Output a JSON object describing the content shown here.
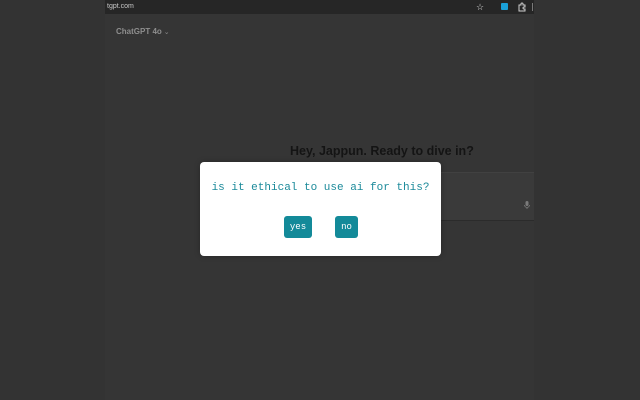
{
  "browser": {
    "url": "tgpt.com",
    "bookmark_icon": "star-icon",
    "extension_icons": [
      "extension-badge-icon",
      "extensions-puzzle-icon"
    ]
  },
  "chat": {
    "model_label": "ChatGPT 4o",
    "model_chevron": "⌄",
    "greeting": "Hey, Jappun. Ready to dive in?",
    "composer_icon": "microphone-icon"
  },
  "modal": {
    "question": "is it ethical to use ai for this?",
    "yes_label": "yes",
    "no_label": "no"
  },
  "colors": {
    "accent": "#138a99",
    "question_text": "#1b8a9a",
    "overlay": "#353535"
  }
}
